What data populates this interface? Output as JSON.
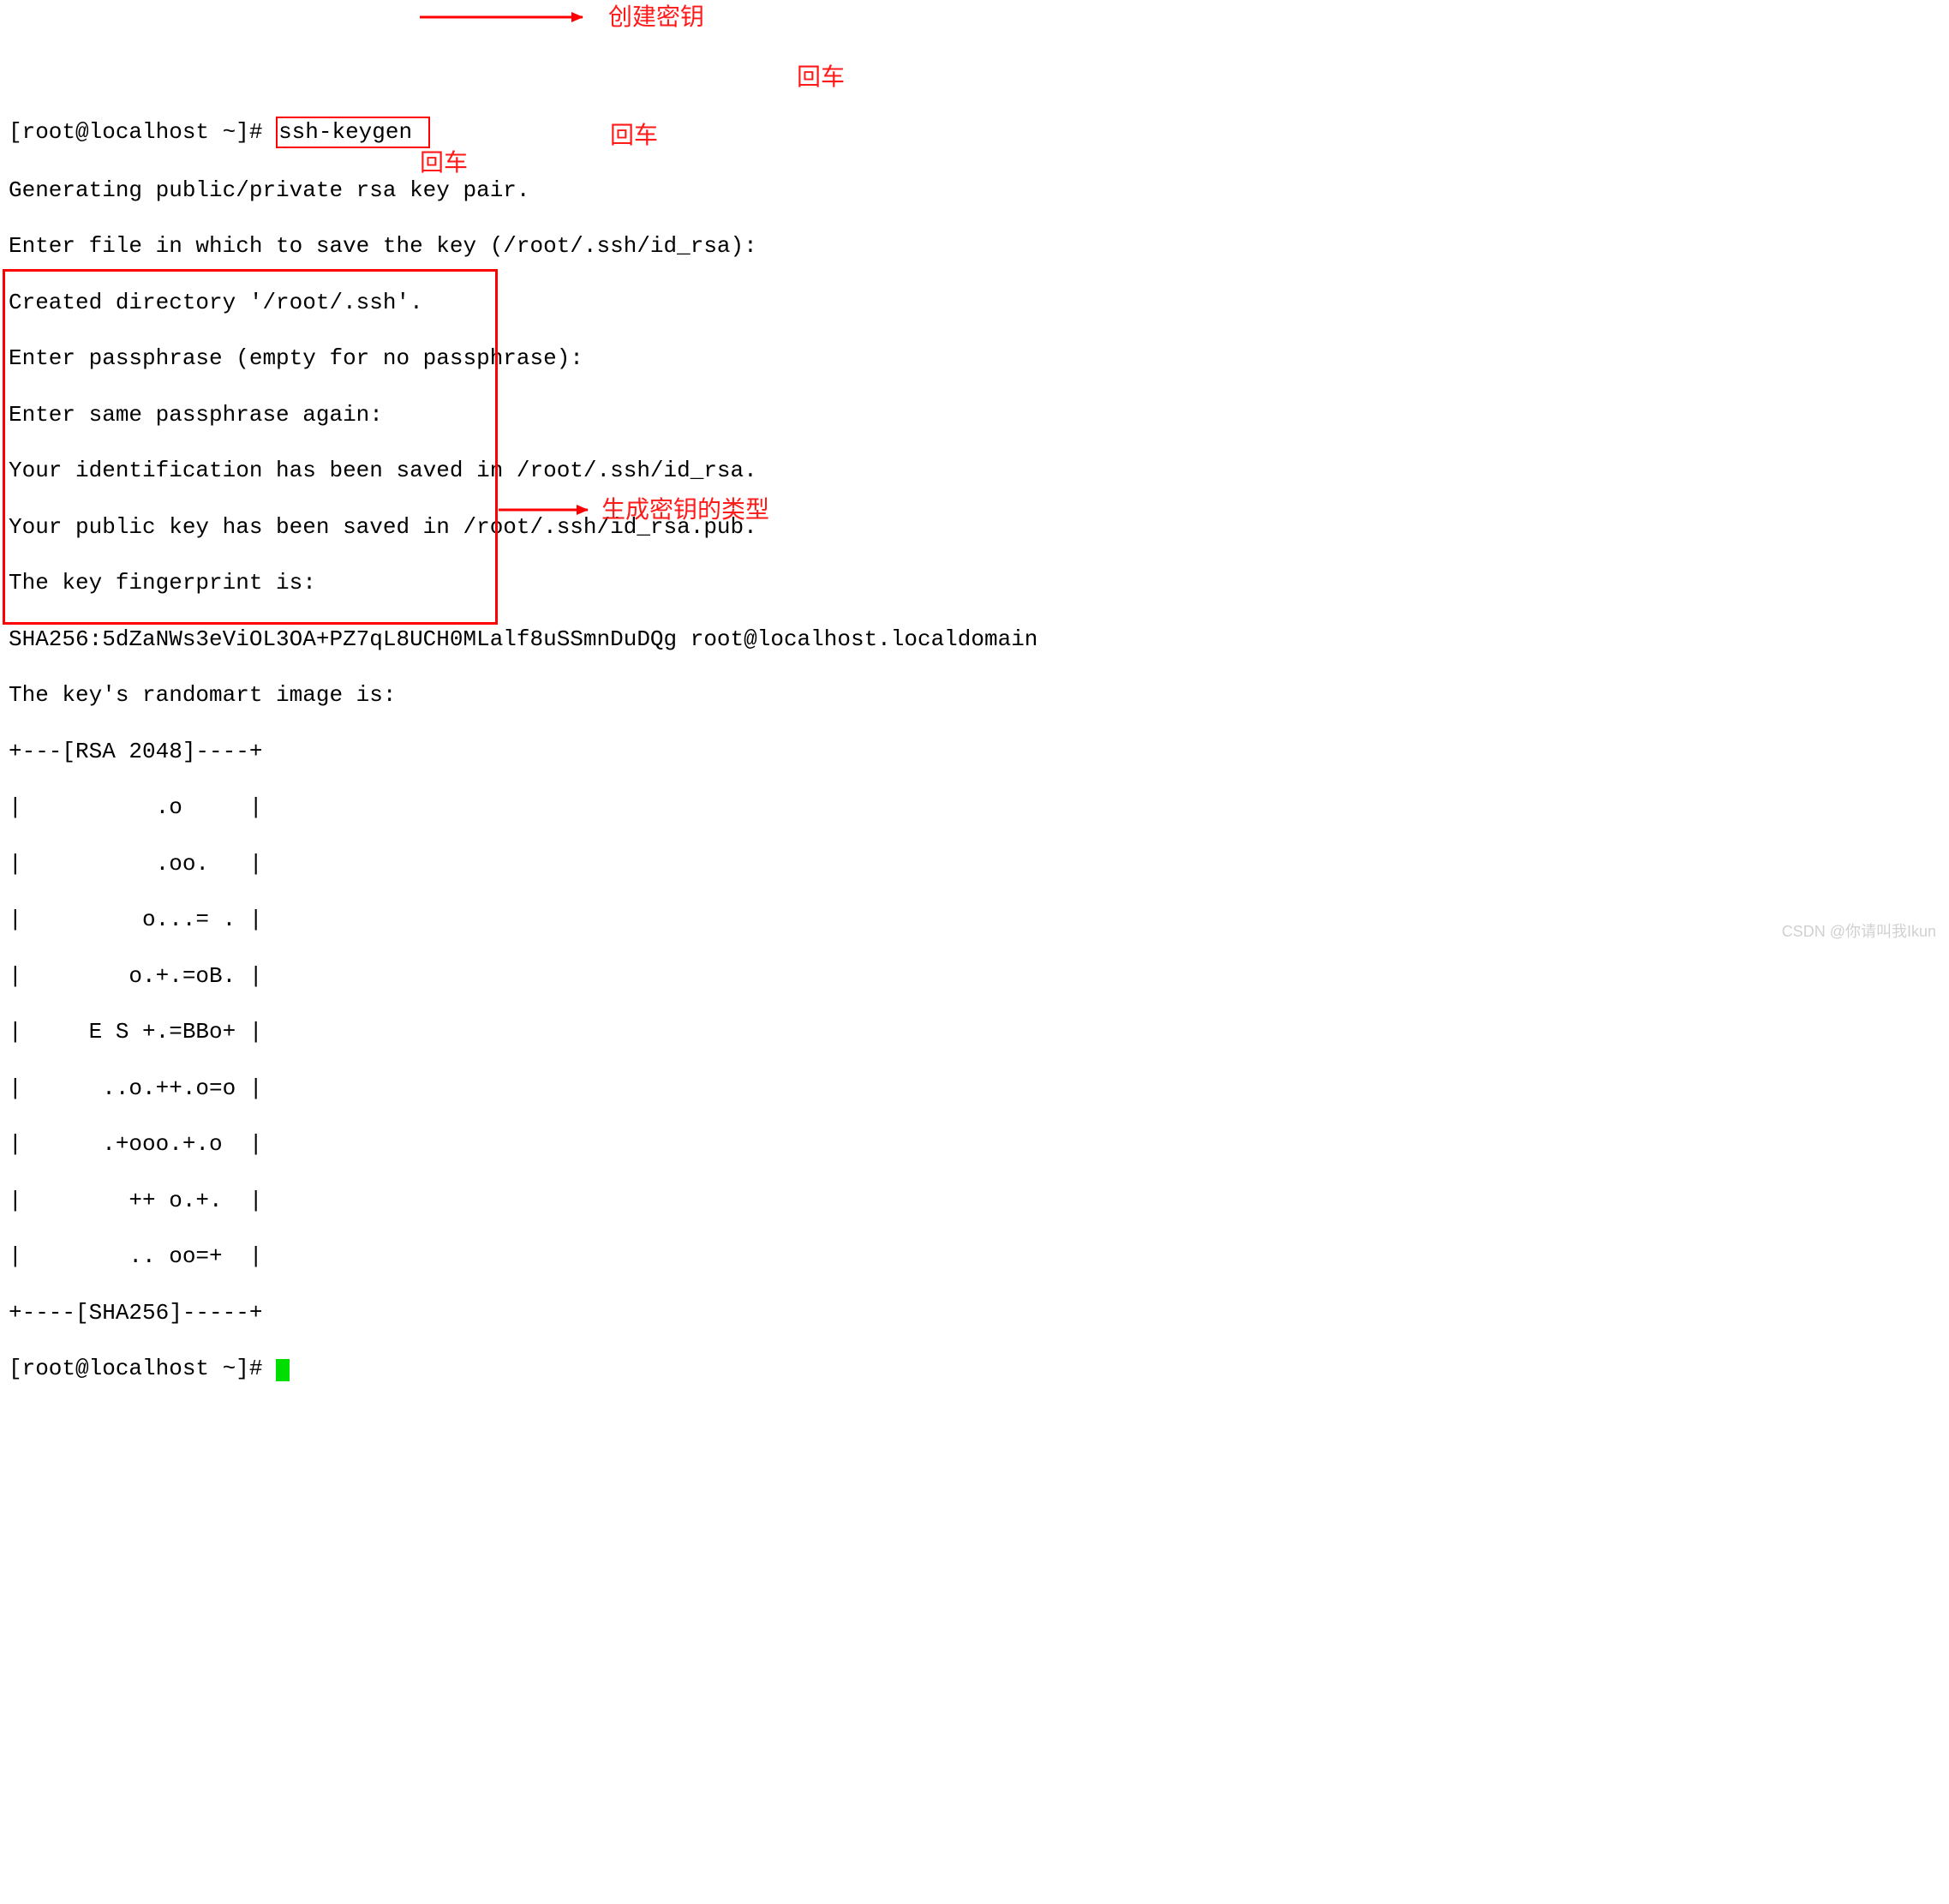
{
  "prompt1": "[root@localhost ~]# ",
  "command": "ssh-keygen ",
  "lines": {
    "l1": "Generating public/private rsa key pair.",
    "l2": "Enter file in which to save the key (/root/.ssh/id_rsa): ",
    "l3": "Created directory '/root/.ssh'.",
    "l4": "Enter passphrase (empty for no passphrase): ",
    "l5": "Enter same passphrase again: ",
    "l6": "Your identification has been saved in /root/.ssh/id_rsa.",
    "l7": "Your public key has been saved in /root/.ssh/id_rsa.pub.",
    "l8": "The key fingerprint is:",
    "l9": "SHA256:5dZaNWs3eViOL3OA+PZ7qL8UCH0MLalf8uSSmnDuDQg root@localhost.localdomain",
    "l10": "The key's randomart image is:",
    "ra0": "+---[RSA 2048]----+",
    "ra1": "|          .o     |",
    "ra2": "|          .oo.   |",
    "ra3": "|         o...= . |",
    "ra4": "|        o.+.=oB. |",
    "ra5": "|     E S +.=BBo+ |",
    "ra6": "|      ..o.++.o=o |",
    "ra7": "|      .+ooo.+.o  |",
    "ra8": "|        ++ o.+.  |",
    "ra9": "|        .. oo=+  |",
    "ra10": "+----[SHA256]-----+"
  },
  "prompt2": "[root@localhost ~]# ",
  "annotation": {
    "a1": "创建密钥",
    "a2": "回车",
    "a3": "回车",
    "a4": "回车",
    "a5": "生成密钥的类型"
  },
  "watermark": "CSDN @你请叫我Ikun"
}
